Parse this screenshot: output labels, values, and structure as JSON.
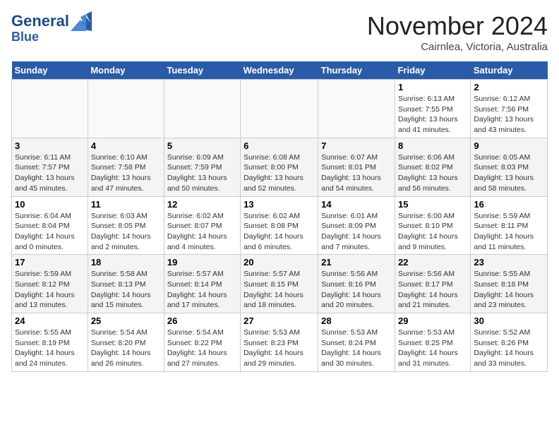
{
  "header": {
    "logo_line1": "General",
    "logo_line2": "Blue",
    "month": "November 2024",
    "location": "Cairnlea, Victoria, Australia"
  },
  "weekdays": [
    "Sunday",
    "Monday",
    "Tuesday",
    "Wednesday",
    "Thursday",
    "Friday",
    "Saturday"
  ],
  "weeks": [
    [
      {
        "day": "",
        "info": ""
      },
      {
        "day": "",
        "info": ""
      },
      {
        "day": "",
        "info": ""
      },
      {
        "day": "",
        "info": ""
      },
      {
        "day": "",
        "info": ""
      },
      {
        "day": "1",
        "info": "Sunrise: 6:13 AM\nSunset: 7:55 PM\nDaylight: 13 hours\nand 41 minutes."
      },
      {
        "day": "2",
        "info": "Sunrise: 6:12 AM\nSunset: 7:56 PM\nDaylight: 13 hours\nand 43 minutes."
      }
    ],
    [
      {
        "day": "3",
        "info": "Sunrise: 6:11 AM\nSunset: 7:57 PM\nDaylight: 13 hours\nand 45 minutes."
      },
      {
        "day": "4",
        "info": "Sunrise: 6:10 AM\nSunset: 7:58 PM\nDaylight: 13 hours\nand 47 minutes."
      },
      {
        "day": "5",
        "info": "Sunrise: 6:09 AM\nSunset: 7:59 PM\nDaylight: 13 hours\nand 50 minutes."
      },
      {
        "day": "6",
        "info": "Sunrise: 6:08 AM\nSunset: 8:00 PM\nDaylight: 13 hours\nand 52 minutes."
      },
      {
        "day": "7",
        "info": "Sunrise: 6:07 AM\nSunset: 8:01 PM\nDaylight: 13 hours\nand 54 minutes."
      },
      {
        "day": "8",
        "info": "Sunrise: 6:06 AM\nSunset: 8:02 PM\nDaylight: 13 hours\nand 56 minutes."
      },
      {
        "day": "9",
        "info": "Sunrise: 6:05 AM\nSunset: 8:03 PM\nDaylight: 13 hours\nand 58 minutes."
      }
    ],
    [
      {
        "day": "10",
        "info": "Sunrise: 6:04 AM\nSunset: 8:04 PM\nDaylight: 14 hours\nand 0 minutes."
      },
      {
        "day": "11",
        "info": "Sunrise: 6:03 AM\nSunset: 8:05 PM\nDaylight: 14 hours\nand 2 minutes."
      },
      {
        "day": "12",
        "info": "Sunrise: 6:02 AM\nSunset: 8:07 PM\nDaylight: 14 hours\nand 4 minutes."
      },
      {
        "day": "13",
        "info": "Sunrise: 6:02 AM\nSunset: 8:08 PM\nDaylight: 14 hours\nand 6 minutes."
      },
      {
        "day": "14",
        "info": "Sunrise: 6:01 AM\nSunset: 8:09 PM\nDaylight: 14 hours\nand 7 minutes."
      },
      {
        "day": "15",
        "info": "Sunrise: 6:00 AM\nSunset: 8:10 PM\nDaylight: 14 hours\nand 9 minutes."
      },
      {
        "day": "16",
        "info": "Sunrise: 5:59 AM\nSunset: 8:11 PM\nDaylight: 14 hours\nand 11 minutes."
      }
    ],
    [
      {
        "day": "17",
        "info": "Sunrise: 5:59 AM\nSunset: 8:12 PM\nDaylight: 14 hours\nand 13 minutes."
      },
      {
        "day": "18",
        "info": "Sunrise: 5:58 AM\nSunset: 8:13 PM\nDaylight: 14 hours\nand 15 minutes."
      },
      {
        "day": "19",
        "info": "Sunrise: 5:57 AM\nSunset: 8:14 PM\nDaylight: 14 hours\nand 17 minutes."
      },
      {
        "day": "20",
        "info": "Sunrise: 5:57 AM\nSunset: 8:15 PM\nDaylight: 14 hours\nand 18 minutes."
      },
      {
        "day": "21",
        "info": "Sunrise: 5:56 AM\nSunset: 8:16 PM\nDaylight: 14 hours\nand 20 minutes."
      },
      {
        "day": "22",
        "info": "Sunrise: 5:56 AM\nSunset: 8:17 PM\nDaylight: 14 hours\nand 21 minutes."
      },
      {
        "day": "23",
        "info": "Sunrise: 5:55 AM\nSunset: 8:18 PM\nDaylight: 14 hours\nand 23 minutes."
      }
    ],
    [
      {
        "day": "24",
        "info": "Sunrise: 5:55 AM\nSunset: 8:19 PM\nDaylight: 14 hours\nand 24 minutes."
      },
      {
        "day": "25",
        "info": "Sunrise: 5:54 AM\nSunset: 8:20 PM\nDaylight: 14 hours\nand 26 minutes."
      },
      {
        "day": "26",
        "info": "Sunrise: 5:54 AM\nSunset: 8:22 PM\nDaylight: 14 hours\nand 27 minutes."
      },
      {
        "day": "27",
        "info": "Sunrise: 5:53 AM\nSunset: 8:23 PM\nDaylight: 14 hours\nand 29 minutes."
      },
      {
        "day": "28",
        "info": "Sunrise: 5:53 AM\nSunset: 8:24 PM\nDaylight: 14 hours\nand 30 minutes."
      },
      {
        "day": "29",
        "info": "Sunrise: 5:53 AM\nSunset: 8:25 PM\nDaylight: 14 hours\nand 31 minutes."
      },
      {
        "day": "30",
        "info": "Sunrise: 5:52 AM\nSunset: 8:26 PM\nDaylight: 14 hours\nand 33 minutes."
      }
    ]
  ]
}
